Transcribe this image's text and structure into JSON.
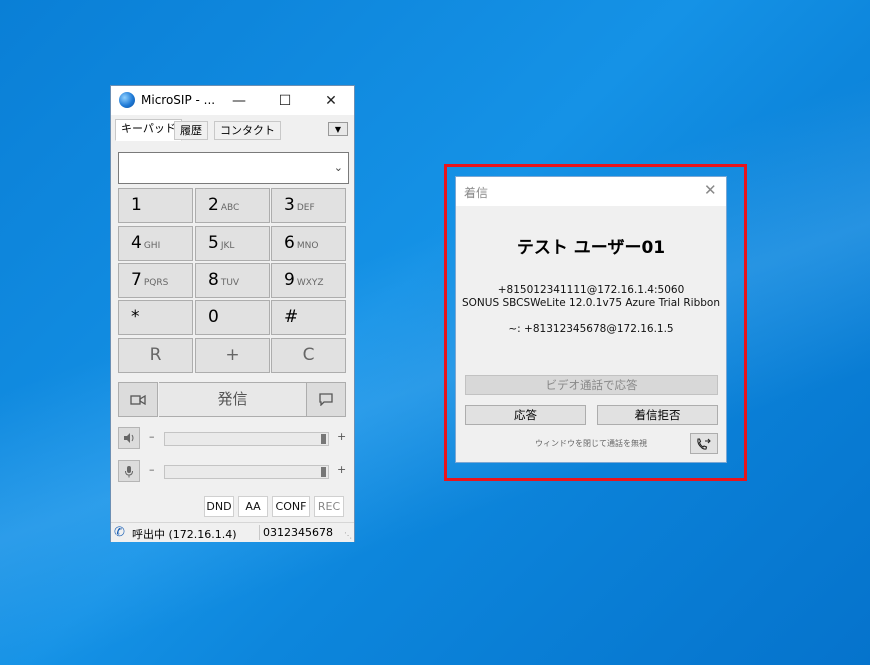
{
  "microsip": {
    "title": "MicroSIP - ...",
    "tabs": [
      "キーパッド",
      "履歴",
      "コンタクト"
    ],
    "tab_menu_glyph": "▼",
    "dial_value": "",
    "keys": [
      {
        "digit": "1",
        "letters": ""
      },
      {
        "digit": "2",
        "letters": "ABC"
      },
      {
        "digit": "3",
        "letters": "DEF"
      },
      {
        "digit": "4",
        "letters": "GHI"
      },
      {
        "digit": "5",
        "letters": "JKL"
      },
      {
        "digit": "6",
        "letters": "MNO"
      },
      {
        "digit": "7",
        "letters": "PQRS"
      },
      {
        "digit": "8",
        "letters": "TUV"
      },
      {
        "digit": "9",
        "letters": "WXYZ"
      },
      {
        "digit": "*",
        "letters": ""
      },
      {
        "digit": "0",
        "letters": ""
      },
      {
        "digit": "#",
        "letters": ""
      }
    ],
    "func_keys": [
      "R",
      "+",
      "C"
    ],
    "call_label": "発信",
    "volume": {
      "minus": "–",
      "plus": "+",
      "speaker_level": 1.0,
      "mic_level": 1.0
    },
    "modes": [
      "DND",
      "AA",
      "CONF",
      "REC"
    ],
    "status": {
      "text": "呼出中 (172.16.1.4)",
      "number": "0312345678"
    }
  },
  "incoming": {
    "title": "着信",
    "caller_name": "テスト ユーザー01",
    "sip_uri": "+815012341111@172.16.1.4:5060",
    "user_agent": "SONUS SBCSWeLite 12.0.1v75 Azure Trial Ribbon",
    "to_line": "~: +81312345678@172.16.1.5",
    "video_answer_label": "ビデオ通話で応答",
    "answer_label": "応答",
    "reject_label": "着信拒否",
    "hint": "ウィンドウを閉じて通話を無視"
  },
  "colors": {
    "highlight": "#e8141c",
    "desktop": "#0a7fd6"
  }
}
